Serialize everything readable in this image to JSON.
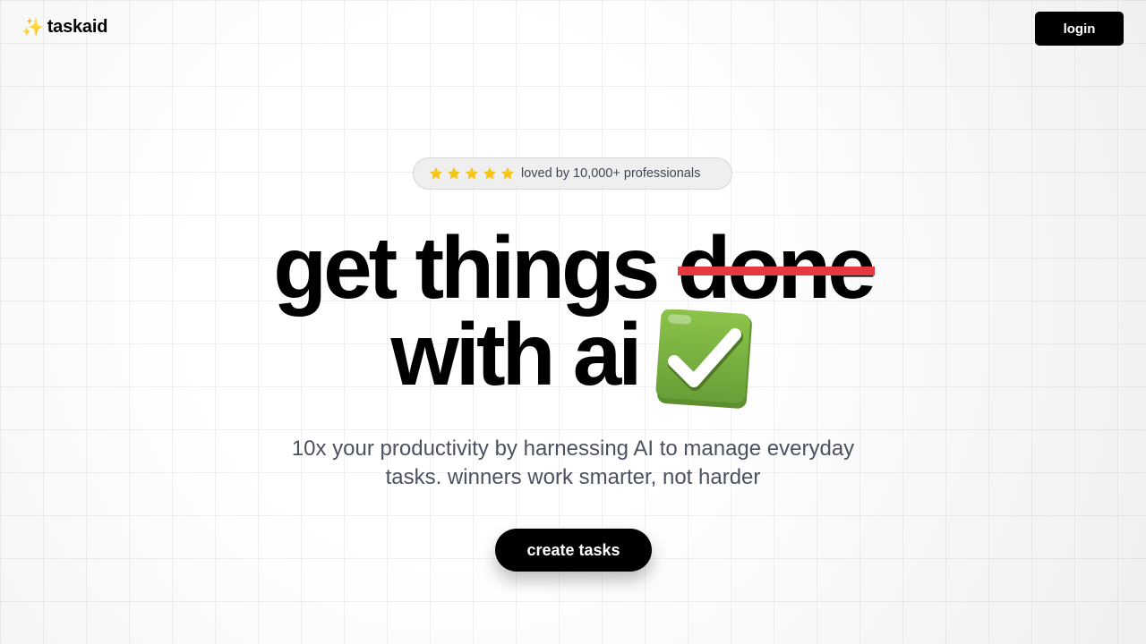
{
  "header": {
    "logo_icon": "sparkles-icon",
    "logo_text": "taskaid",
    "login_label": "login"
  },
  "badge": {
    "rating": 5,
    "star_color": "#f5c518",
    "text": "loved by 10,000+ professionals"
  },
  "hero": {
    "line1_prefix": "get things ",
    "line1_struck": "done",
    "line2_text": "with ai",
    "line2_icon": "check-mark-button-icon",
    "strike_color": "#e5393f",
    "check_color": "#7cb342",
    "subtitle_line1": "10x your productivity by harnessing AI to manage everyday",
    "subtitle_line2": "tasks. winners work smarter, not harder",
    "cta_label": "create tasks"
  }
}
